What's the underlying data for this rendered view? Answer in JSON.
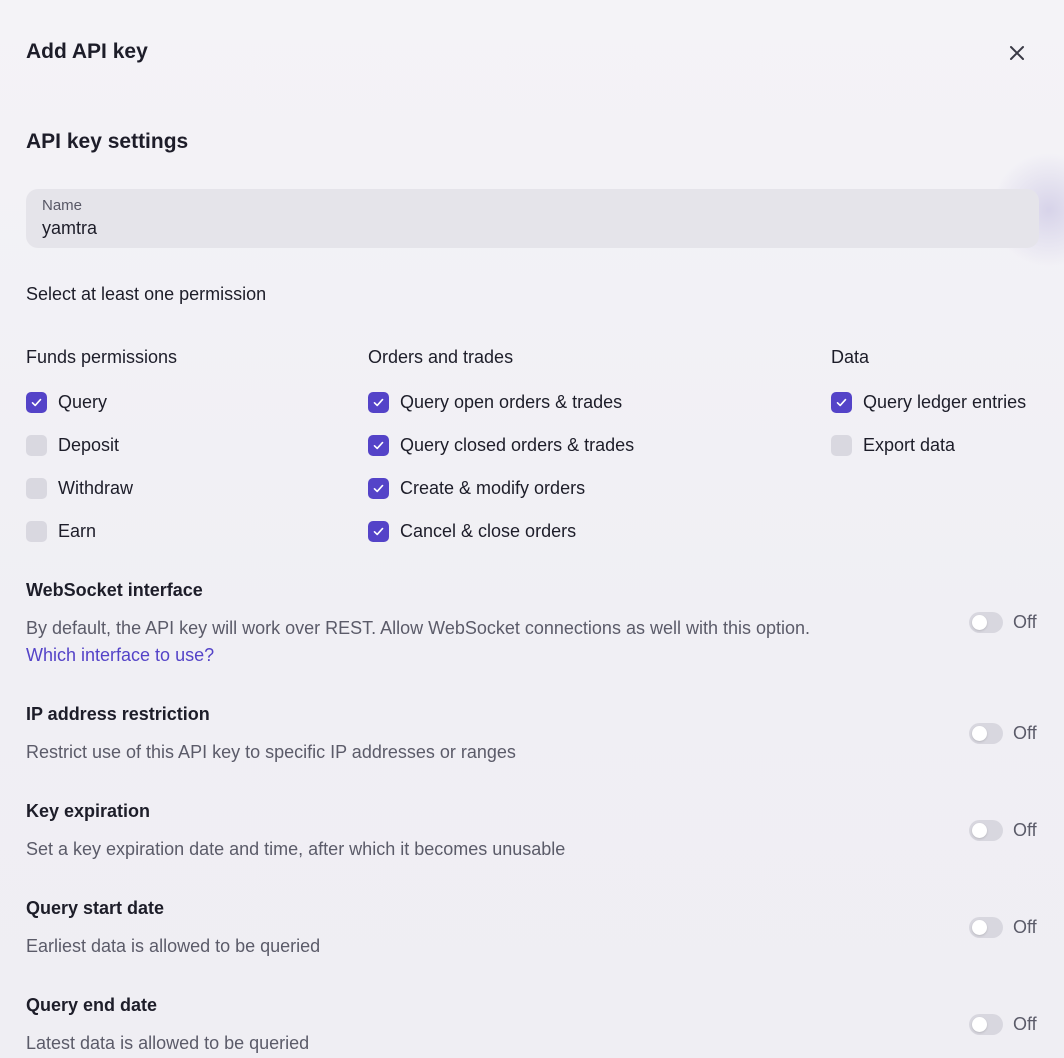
{
  "dialog": {
    "title": "Add API key",
    "close_icon": "close-icon"
  },
  "settings": {
    "title": "API key settings",
    "name_field": {
      "label": "Name",
      "value": "yamtra"
    },
    "permission_prompt": "Select at least one permission"
  },
  "permissions": {
    "funds": {
      "heading": "Funds permissions",
      "items": [
        {
          "label": "Query",
          "checked": true
        },
        {
          "label": "Deposit",
          "checked": false
        },
        {
          "label": "Withdraw",
          "checked": false
        },
        {
          "label": "Earn",
          "checked": false
        }
      ]
    },
    "orders": {
      "heading": "Orders and trades",
      "items": [
        {
          "label": "Query open orders & trades",
          "checked": true
        },
        {
          "label": "Query closed orders & trades",
          "checked": true
        },
        {
          "label": "Create & modify orders",
          "checked": true
        },
        {
          "label": "Cancel & close orders",
          "checked": true
        }
      ]
    },
    "data": {
      "heading": "Data",
      "items": [
        {
          "label": "Query ledger entries",
          "checked": true
        },
        {
          "label": "Export data",
          "checked": false
        }
      ]
    }
  },
  "options": {
    "websocket": {
      "title": "WebSocket interface",
      "description": "By default, the API key will work over REST. Allow WebSocket connections as well with this option.",
      "link": "Which interface to use?",
      "state": "Off"
    },
    "ip_restriction": {
      "title": "IP address restriction",
      "description": "Restrict use of this API key to specific IP addresses or ranges",
      "state": "Off"
    },
    "key_expiration": {
      "title": "Key expiration",
      "description": "Set a key expiration date and time, after which it becomes unusable",
      "state": "Off"
    },
    "query_start": {
      "title": "Query start date",
      "description": "Earliest data is allowed to be queried",
      "state": "Off"
    },
    "query_end": {
      "title": "Query end date",
      "description": "Latest data is allowed to be queried",
      "state": "Off"
    }
  },
  "colors": {
    "accent": "#5443c8",
    "checkbox_off": "#d9d8e0",
    "toggle_off": "#d8d7df",
    "background": "#f1f0f5"
  }
}
